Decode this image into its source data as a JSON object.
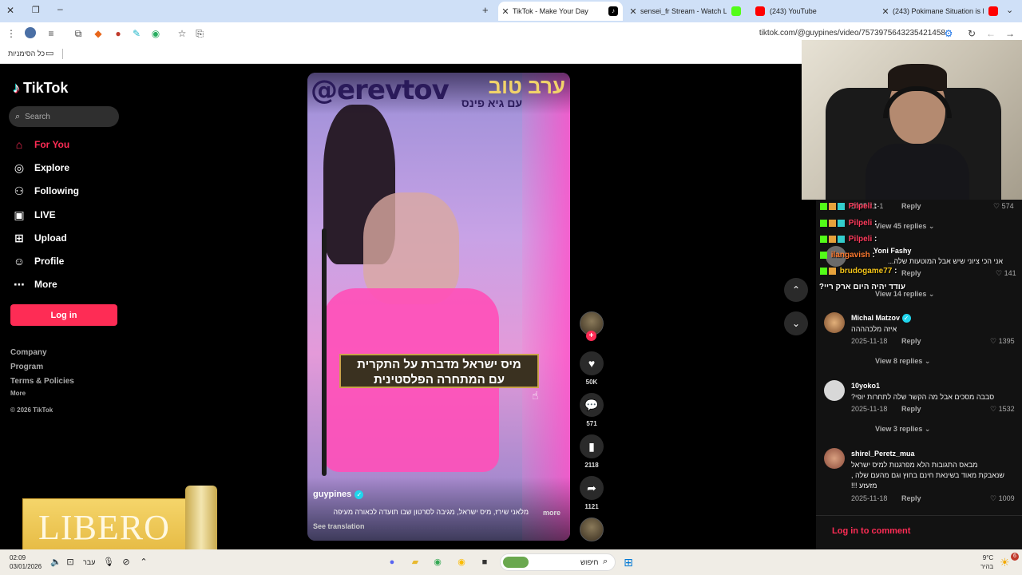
{
  "tabs": [
    {
      "label": "TikTok - Make Your Day",
      "active": true
    },
    {
      "label": "sensei_fr Stream - Watch Live o"
    },
    {
      "label": "(243) YouTube"
    },
    {
      "label": "(243) Pokimane Situation is Pa"
    }
  ],
  "toolbar": {
    "url": "tiktok.com/@guypines/video/7573975643235421458"
  },
  "bookmarks": {
    "all_bookmarks": "כל הסימניות"
  },
  "sidebar": {
    "logo": "TikTok",
    "search_placeholder": "Search",
    "nav": [
      {
        "label": "For You",
        "icon": "home-icon",
        "active": true
      },
      {
        "label": "Explore",
        "icon": "compass-icon"
      },
      {
        "label": "Following",
        "icon": "following-icon"
      },
      {
        "label": "LIVE",
        "icon": "live-icon"
      },
      {
        "label": "Upload",
        "icon": "upload-icon"
      },
      {
        "label": "Profile",
        "icon": "profile-icon"
      },
      {
        "label": "More",
        "icon": "more-icon"
      }
    ],
    "login": "Log in",
    "footer": [
      "Company",
      "Program",
      "Terms & Policies"
    ],
    "footer_more": "More",
    "copyright": "© 2026 TikTok"
  },
  "ad": {
    "brand": "LIBERO"
  },
  "video": {
    "handle_overlay": "@erevtov",
    "brand_he": "ערב טוב",
    "brand_sub": "עם גיא פינס",
    "caption_line1": "מיס ישראל מדברת על התקרית",
    "caption_line2": "עם המתחרה הפלסטינית",
    "author": "guypines",
    "description": "מלאני שירז, מיס ישראל, מגיבה לסרטון שבו תועדה לכאורה מעיפה",
    "more": "more",
    "see_translation": "See translation"
  },
  "actions": {
    "likes": "50K",
    "comments": "571",
    "saves": "2118",
    "shares": "1121"
  },
  "comments": [
    {
      "user": "Yoni Fashy",
      "text": "אני הכי ציוני שיש אבל המוטעות שלה...",
      "date": "",
      "likes": "141",
      "view": "View 14 replies",
      "reply": "Reply"
    },
    {
      "user": "Michal Matzov",
      "text": "איזה מלכהההה",
      "date": "2025-11-18",
      "likes": "1395",
      "view": "View 8 replies",
      "reply": "Reply"
    },
    {
      "user": "10yoko1",
      "text": "סבבה מסכים אבל מה הקשר שלה לתחרות יופי?",
      "date": "2025-11-18",
      "likes": "1532",
      "view": "View 3 replies",
      "reply": "Reply"
    },
    {
      "user": "shirel_Peretz_mua",
      "text1": "מבאס התגובות הלא מפרגנות למיס ישראל",
      "text2": "שנאבקת מאוד בשינאת חינם בחוץ וגם מהעם שלה ,",
      "text3": "מזעזע !!!",
      "date": "2025-11-18",
      "likes": "1009",
      "reply": "Reply"
    }
  ],
  "comment_top": {
    "date": "2025-11-1",
    "reply": "Reply",
    "likes": "574",
    "view": "View 45 replies",
    "reply2": "Reply"
  },
  "login_comment": "Log in to comment",
  "chat": [
    {
      "user": "Pilpeli",
      "msg": ":",
      "color": "#ff3b5c"
    },
    {
      "user": "Pilpeli",
      "msg": ":",
      "color": "#ff3b5c"
    },
    {
      "user": "Pilpeli",
      "msg": ":",
      "color": "#ff3b5c"
    },
    {
      "user": "ilangavish",
      "msg": ":",
      "color": "#ff7a2f"
    },
    {
      "user": "brudogame77",
      "msg": ":",
      "color": "#f5c518"
    }
  ],
  "chat_line": "עודד יהיה היום ארק ריי?",
  "taskbar": {
    "time": "02:09",
    "date": "03/01/2026",
    "lang": "עבר",
    "search": "חיפוש",
    "weather_temp": "9°C",
    "weather_desc": "בהיר",
    "notif": "6"
  }
}
